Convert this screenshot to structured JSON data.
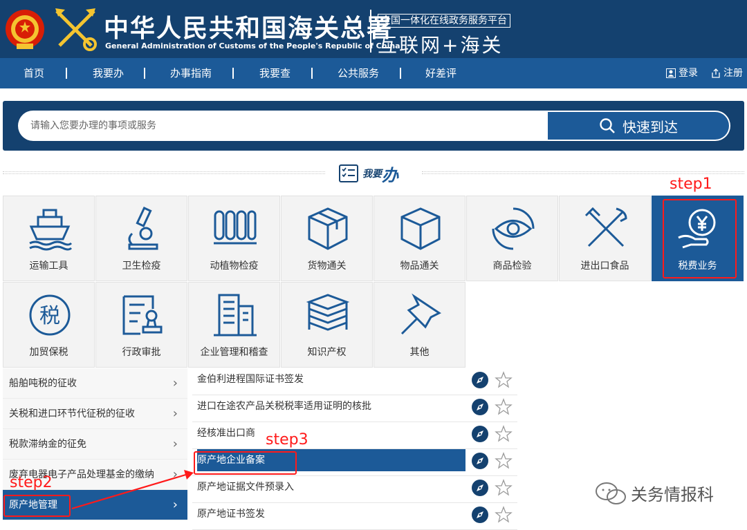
{
  "header": {
    "title": "中华人民共和国海关总署",
    "subtitle": "General Administration of Customs of the People's Republic of China",
    "platform_badge": "全国一体化在线政务服务平台",
    "platform_name": "互联网+海关"
  },
  "nav": {
    "items": [
      "首页",
      "我要办",
      "办事指南",
      "我要查",
      "公共服务",
      "好差评"
    ],
    "login": "登录",
    "register": "注册"
  },
  "search": {
    "placeholder": "请输入您要办理的事项或服务",
    "button": "快速到达"
  },
  "section": {
    "title_small": "我要",
    "title_big": "办"
  },
  "categories": {
    "items": [
      {
        "label": "运输工具",
        "icon": "ship-icon"
      },
      {
        "label": "卫生检疫",
        "icon": "microscope-icon"
      },
      {
        "label": "动植物检疫",
        "icon": "test-tubes-icon"
      },
      {
        "label": "货物通关",
        "icon": "package-icon"
      },
      {
        "label": "物品通关",
        "icon": "cube-icon"
      },
      {
        "label": "商品检验",
        "icon": "eye-icon"
      },
      {
        "label": "进出口食品",
        "icon": "fork-knife-icon"
      },
      {
        "label": "税费业务",
        "icon": "yen-hand-icon"
      },
      {
        "label": "加贸保税",
        "icon": "tax-circle-icon"
      },
      {
        "label": "行政审批",
        "icon": "stamp-form-icon"
      },
      {
        "label": "企业管理和稽查",
        "icon": "building-icon"
      },
      {
        "label": "知识产权",
        "icon": "books-icon"
      },
      {
        "label": "其他",
        "icon": "pin-icon"
      }
    ],
    "active": "税费业务"
  },
  "left_menu": {
    "items": [
      "船舶吨税的征收",
      "关税和进口环节代征税的征收",
      "税款滞纳金的征免",
      "废弃电器电子产品处理基金的缴纳",
      "原产地管理"
    ],
    "active": "原产地管理"
  },
  "right_menu": {
    "items": [
      "金伯利进程国际证书签发",
      "进口在途农产品关税税率适用证明的核批",
      "经核准出口商",
      "原产地企业备案",
      "原产地证据文件预录入",
      "原产地证书签发"
    ],
    "active": "原产地企业备案"
  },
  "annotations": {
    "step1": "step1",
    "step2": "step2",
    "step3": "step3"
  },
  "watermark": "关务情报科",
  "colors": {
    "header_bg": "#14416f",
    "nav_bg": "#1c5a98",
    "active_bg": "#1c5a98",
    "annotation_red": "#ff1a1a"
  }
}
